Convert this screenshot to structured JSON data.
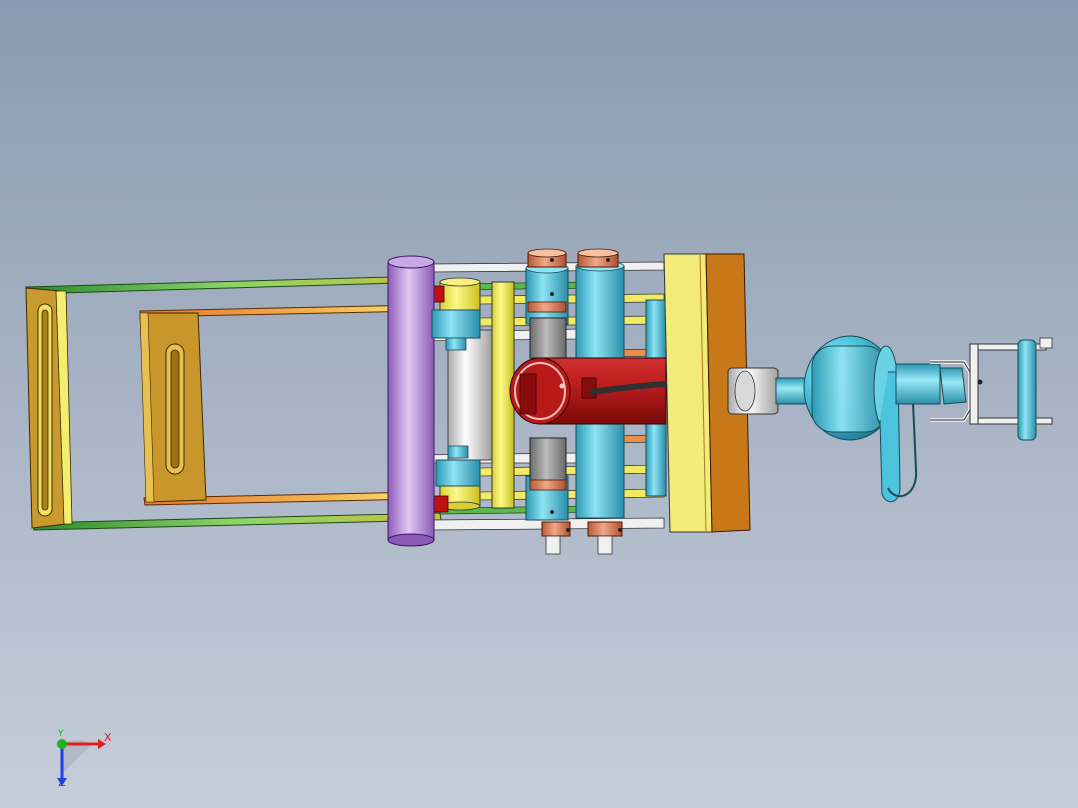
{
  "viewport": {
    "background_top": "#8a9ab0",
    "background_bottom": "#c6ceda"
  },
  "model": {
    "colors": {
      "frame_green": "#3fae3f",
      "bracket_gold": "#c8a040",
      "plate_yellow": "#f2e560",
      "roller_purple": "#b486d6",
      "cylinder_red": "#b01818",
      "bearing_cyan": "#4cc4dc",
      "collar_copper": "#d8805a",
      "block_orange": "#c87818",
      "shaft_white": "#e8e8e8",
      "hose_black": "#303030"
    }
  },
  "triad": {
    "x_label": "X",
    "y_label": "Y",
    "z_label": "Z",
    "x_color": "#e02020",
    "y_color": "#20b020",
    "z_color": "#2040e0"
  }
}
